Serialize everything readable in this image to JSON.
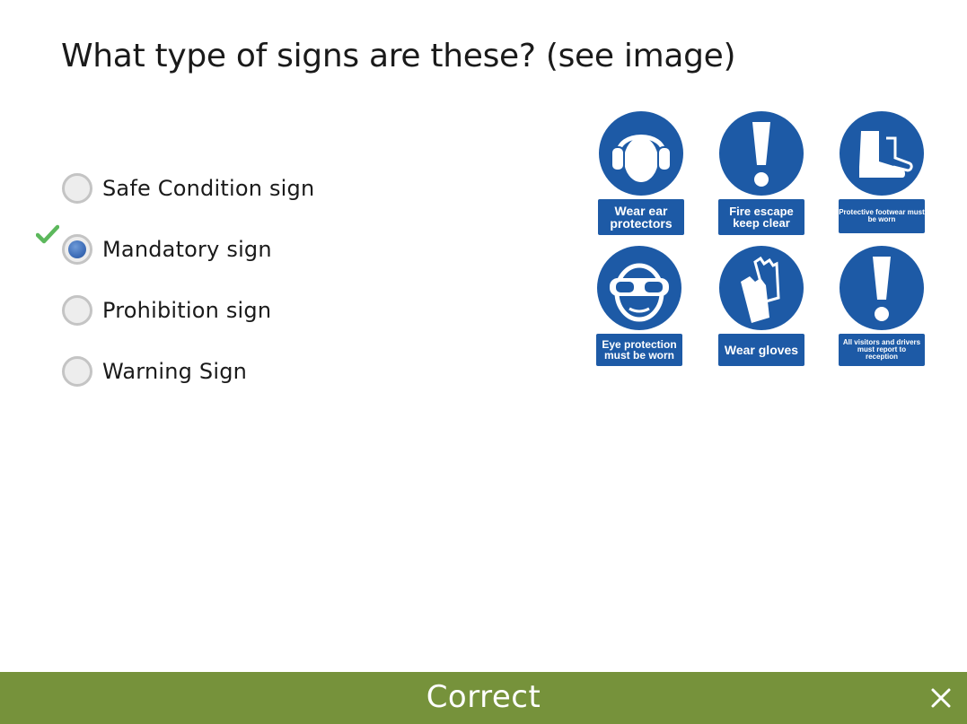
{
  "question": {
    "text": "What type of signs are these? (see image)"
  },
  "options": [
    {
      "label": "Safe Condition sign",
      "selected": false,
      "correct": false
    },
    {
      "label": "Mandatory sign",
      "selected": true,
      "correct": true
    },
    {
      "label": "Prohibition sign",
      "selected": false,
      "correct": false
    },
    {
      "label": "Warning Sign",
      "selected": false,
      "correct": false
    }
  ],
  "signs": [
    {
      "icon": "ear-defenders-icon",
      "caption": "Wear ear protectors"
    },
    {
      "icon": "exclamation-icon",
      "caption": "Fire escape keep clear"
    },
    {
      "icon": "boot-icon",
      "caption": "Protective footwear must be worn"
    },
    {
      "icon": "goggles-icon",
      "caption": "Eye protection must be worn"
    },
    {
      "icon": "gloves-icon",
      "caption": "Wear gloves"
    },
    {
      "icon": "exclamation-icon",
      "caption": "All visitors and drivers must report to reception"
    }
  ],
  "feedback": {
    "text": "Correct",
    "close_icon": "close-icon"
  },
  "colors": {
    "sign_blue": "#1d5aa6",
    "feedback_bar": "#76923b",
    "check_green": "#5cb85c",
    "radio_dot": "#3d6db8"
  }
}
